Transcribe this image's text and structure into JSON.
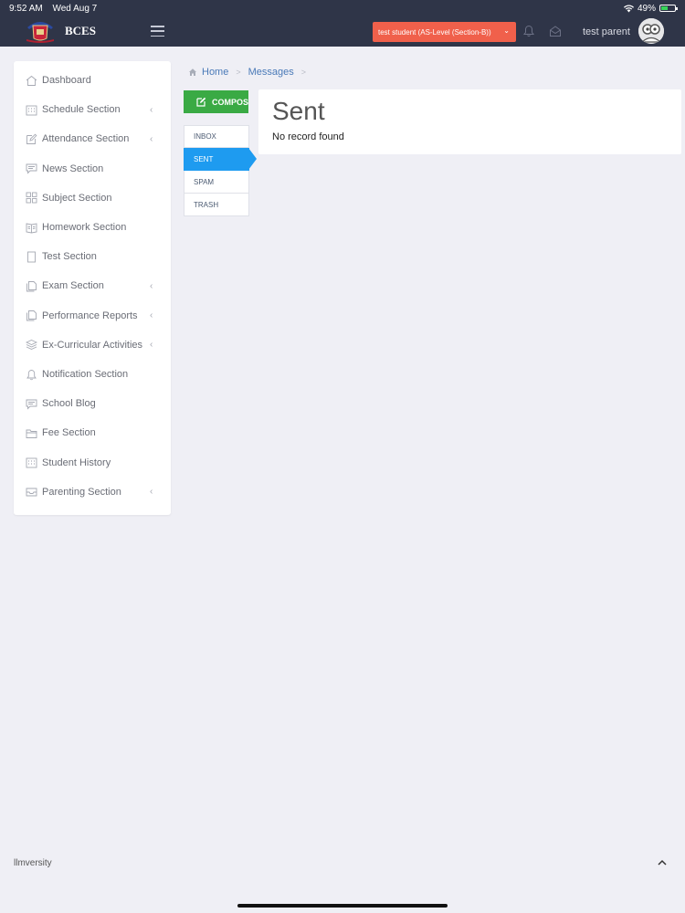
{
  "status_bar": {
    "time": "9:52 AM",
    "date": "Wed Aug 7",
    "battery": "49%",
    "battery_level": 0.49
  },
  "navbar": {
    "brand": "BCES",
    "student_selector": "test student (AS-Level (Section-B))",
    "user_name": "test parent"
  },
  "sidebar": {
    "items": [
      {
        "label": "Dashboard",
        "icon": "home-icon",
        "has_children": false
      },
      {
        "label": "Schedule Section",
        "icon": "calendar-icon",
        "has_children": true
      },
      {
        "label": "Attendance Section",
        "icon": "edit-icon",
        "has_children": true
      },
      {
        "label": "News Section",
        "icon": "chat-icon",
        "has_children": false
      },
      {
        "label": "Subject Section",
        "icon": "grid-icon",
        "has_children": false
      },
      {
        "label": "Homework Section",
        "icon": "book-icon",
        "has_children": false
      },
      {
        "label": "Test Section",
        "icon": "document-icon",
        "has_children": false
      },
      {
        "label": "Exam Section",
        "icon": "copy-icon",
        "has_children": true
      },
      {
        "label": "Performance Reports",
        "icon": "copy-icon",
        "has_children": true
      },
      {
        "label": "Ex-Curricular Activities",
        "icon": "layers-icon",
        "has_children": true
      },
      {
        "label": "Notification Section",
        "icon": "bell-icon",
        "has_children": false
      },
      {
        "label": "School Blog",
        "icon": "chat-icon",
        "has_children": false
      },
      {
        "label": "Fee Section",
        "icon": "folder-icon",
        "has_children": false
      },
      {
        "label": "Student History",
        "icon": "calendar-icon",
        "has_children": false
      },
      {
        "label": "Parenting Section",
        "icon": "inbox-icon",
        "has_children": true
      }
    ]
  },
  "breadcrumb": {
    "home": "Home",
    "current": "Messages"
  },
  "mail": {
    "compose_label": "COMPOSE",
    "folders": [
      {
        "label": "INBOX",
        "active": false
      },
      {
        "label": "SENT",
        "active": true
      },
      {
        "label": "SPAM",
        "active": false
      },
      {
        "label": "TRASH",
        "active": false
      }
    ],
    "panel_title": "Sent",
    "empty_message": "No record found"
  },
  "footer": {
    "text": "llmversity"
  },
  "colors": {
    "navbar": "#2f3548",
    "compose": "#3aaa44",
    "active_folder": "#1e9bf0",
    "student_selector": "#f0604b",
    "background": "#efeff5"
  }
}
